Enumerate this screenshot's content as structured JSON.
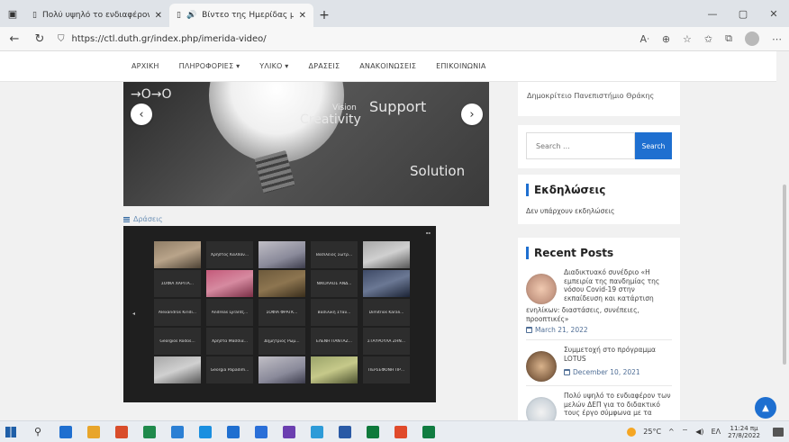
{
  "browser": {
    "tabs": [
      {
        "title": "Πολύ υψηλό το ενδιαφέρον τω",
        "active": false
      },
      {
        "title": "Βίντεο της Ημερίδας με θέ",
        "active": true
      }
    ],
    "url": "https://ctl.duth.gr/index.php/imerida-video/",
    "new_tab_glyph": "+"
  },
  "nav": {
    "items": [
      "ΑΡΧΙΚΗ",
      "ΠΛΗΡΟΦΟΡΙΕΣ ▾",
      "ΥΛΙΚΟ ▾",
      "ΔΡΑΣΕΙΣ",
      "ΑΝΑΚΟΙΝΩΣΕΙΣ",
      "ΕΠΙΚΟΙΝΩΝΙΑ"
    ]
  },
  "slider": {
    "words": {
      "vision": "Vision",
      "creativity": "Creativity",
      "support": "Support",
      "solution": "Solution",
      "left": "→O→O"
    },
    "prev": "‹",
    "next": "›"
  },
  "video": {
    "category_label": "Δράσεις",
    "tiles": [
      {
        "name": "",
        "style": "cam"
      },
      {
        "name": "Χρήστος Καλπαν...",
        "style": ""
      },
      {
        "name": "",
        "style": "cam2"
      },
      {
        "name": "Βασίλειος Σωτρ...",
        "style": ""
      },
      {
        "name": "",
        "style": "cam6"
      },
      {
        "name": "ΣΟΦΙΑ ΧΑΡΙΤΑ...",
        "style": ""
      },
      {
        "name": "",
        "style": "cam3"
      },
      {
        "name": "",
        "style": "cam4"
      },
      {
        "name": "ΝΙΚΟΛΑΟΣ ΑΝΔ...",
        "style": ""
      },
      {
        "name": "",
        "style": "cam5"
      },
      {
        "name": "Alexandros Kiridi...",
        "style": ""
      },
      {
        "name": "Andreas Lyrantζ...",
        "style": ""
      },
      {
        "name": "ΣΟΦΙΑ ΦΡΑΓΚ...",
        "style": ""
      },
      {
        "name": "Βασιλική Σταυ...",
        "style": ""
      },
      {
        "name": "Dimitrios Karali...",
        "style": ""
      },
      {
        "name": "Georgios Rodos...",
        "style": ""
      },
      {
        "name": "Χρήστα Μάσσια...",
        "style": ""
      },
      {
        "name": "Δημήτριος Ρωμ...",
        "style": ""
      },
      {
        "name": "ΕΛΕΝΗ ΠΑΝΤΑΖ...",
        "style": ""
      },
      {
        "name": "ΣΤΑΥΡΟΥΛΑ ΖΗΝ...",
        "style": ""
      },
      {
        "name": "",
        "style": "cam6"
      },
      {
        "name": "Georgia Papadim...",
        "style": ""
      },
      {
        "name": "",
        "style": "cam2"
      },
      {
        "name": "",
        "style": "cam7"
      },
      {
        "name": "ΠΕΡΣΕΦΟΝΗ ΠΡ...",
        "style": ""
      }
    ]
  },
  "sidebar": {
    "top_text": "Δημοκρίτειο Πανεπιστήμιο Θράκης",
    "search": {
      "placeholder": "Search ...",
      "button": "Search"
    },
    "events": {
      "heading": "Εκδηλώσεις",
      "text": "Δεν υπάρχουν εκδηλώσεις"
    },
    "posts": {
      "heading": "Recent Posts",
      "items": [
        {
          "title": "Διαδικτυακό συνέδριο «Η εμπειρία της πανδημίας της νόσου Covid-19 στην εκπαίδευση και κατάρτιση",
          "title_cont": "ενηλίκων: διαστάσεις, συνέπειες, προοπτικές»",
          "date": "March 21, 2022"
        },
        {
          "title": "Συμμετοχή στο πρόγραμμα LOTUS",
          "date": "December 10, 2021"
        },
        {
          "title": "Πολύ υψηλό το ενδιαφέρον των μελών ΔΕΠ για το διδακτικό τους έργο σύμφωνα με τα",
          "date": ""
        }
      ]
    }
  },
  "taskbar": {
    "weather": "25°C",
    "lang": "ΕΛ",
    "time": "11:24 πμ",
    "date": "27/8/2022",
    "app_colors": [
      "#1f6fd0",
      "#e8a52b",
      "#d94d2b",
      "#1f8a4c",
      "#2b7fd4",
      "#1a8fe0",
      "#1f6fd0",
      "#2a6fd8",
      "#6b3fb0",
      "#2d9bd8",
      "#2a5aa6",
      "#0f7a3c",
      "#e04a2b",
      "#107c41"
    ]
  },
  "ui": {
    "back": "←",
    "reload": "↻",
    "lock": "🔒",
    "scroll_top": "▲"
  }
}
